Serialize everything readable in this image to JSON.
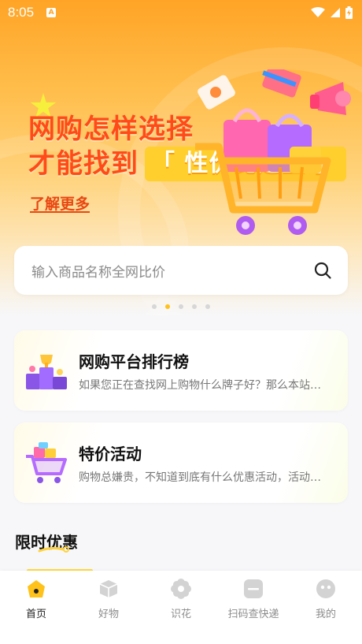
{
  "status_bar": {
    "time": "8:05",
    "icons": [
      "a-notification-icon",
      "wifi-icon",
      "signal-icon",
      "battery-icon"
    ]
  },
  "banner": {
    "headline_line1": "网购怎样选择",
    "headline_line2_prefix": "才能找到",
    "headline_line2_highlight": "「 性价比之王 」",
    "cta": "了解更多",
    "carousel_total": 5,
    "carousel_active_index": 1
  },
  "search": {
    "placeholder": "输入商品名称全网比价"
  },
  "cards": [
    {
      "title": "网购平台排行榜",
      "desc": "如果您正在查找网上购物什么牌子好？那么本站可以帮您"
    },
    {
      "title": "特价活动",
      "desc": "购物总嫌贵，不知道到底有什么优惠活动，活动那么多"
    }
  ],
  "section": {
    "title": "限时优惠"
  },
  "tabbar": {
    "tabs": [
      {
        "label": "首页",
        "icon": "home-icon",
        "active": true
      },
      {
        "label": "好物",
        "icon": "box-icon",
        "active": false
      },
      {
        "label": "识花",
        "icon": "flower-icon",
        "active": false
      },
      {
        "label": "扫码查快递",
        "icon": "scan-icon",
        "active": false
      },
      {
        "label": "我的",
        "icon": "profile-icon",
        "active": false
      }
    ]
  },
  "colors": {
    "brand_orange": "#ffa426",
    "headline_red": "#ff4a1a",
    "accent_yellow": "#ffc21a"
  }
}
